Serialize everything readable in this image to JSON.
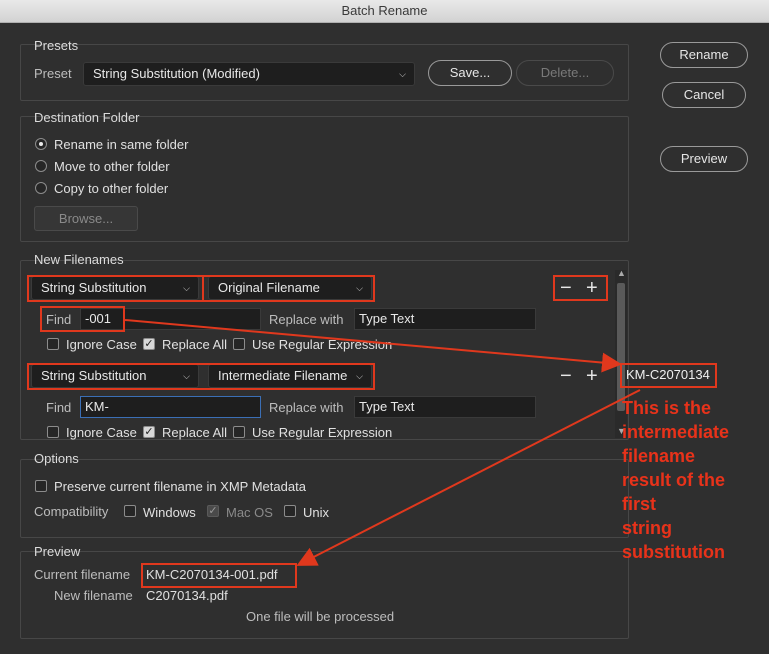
{
  "window": {
    "title": "Batch Rename"
  },
  "presets": {
    "section_title": "Presets",
    "preset_label": "Preset",
    "preset_value": "String Substitution (Modified)",
    "save_label": "Save...",
    "delete_label": "Delete..."
  },
  "actions": {
    "rename": "Rename",
    "cancel": "Cancel",
    "preview": "Preview"
  },
  "destination": {
    "section_title": "Destination Folder",
    "options": [
      "Rename in same folder",
      "Move to other folder",
      "Copy to other folder"
    ],
    "selected_index": 0,
    "browse_label": "Browse..."
  },
  "new_filenames": {
    "section_title": "New Filenames",
    "rows": [
      {
        "type": "String Substitution",
        "source": "Original Filename",
        "find_label": "Find",
        "find_value": "-001",
        "replace_label": "Replace with",
        "replace_value": "Type Text",
        "ignore_case": "Ignore Case",
        "ignore_case_checked": false,
        "replace_all": "Replace All",
        "replace_all_checked": true,
        "regex": "Use Regular Expression",
        "regex_checked": false
      },
      {
        "type": "String Substitution",
        "source": "Intermediate Filename",
        "find_label": "Find",
        "find_value": "KM-",
        "replace_label": "Replace with",
        "replace_value": "Type Text",
        "ignore_case": "Ignore Case",
        "ignore_case_checked": false,
        "replace_all": "Replace All",
        "replace_all_checked": true,
        "regex": "Use Regular Expression",
        "regex_checked": false
      }
    ],
    "minus_symbol": "−",
    "plus_symbol": "+"
  },
  "options": {
    "section_title": "Options",
    "preserve_label": "Preserve current filename in XMP Metadata",
    "preserve_checked": false,
    "compatibility_label": "Compatibility",
    "windows": "Windows",
    "mac_os": "Mac OS",
    "unix": "Unix"
  },
  "preview": {
    "section_title": "Preview",
    "current_label": "Current filename",
    "current_value": "KM-C2070134-001.pdf",
    "new_label": "New filename",
    "new_value": "C2070134.pdf",
    "status": "One file will be processed"
  },
  "annotation": {
    "intermediate_value": "KM-C2070134",
    "note_lines": [
      "This is the",
      "intermediate",
      "filename",
      "result of the",
      "first",
      "string",
      "substitution"
    ],
    "color": "#e0381d"
  }
}
